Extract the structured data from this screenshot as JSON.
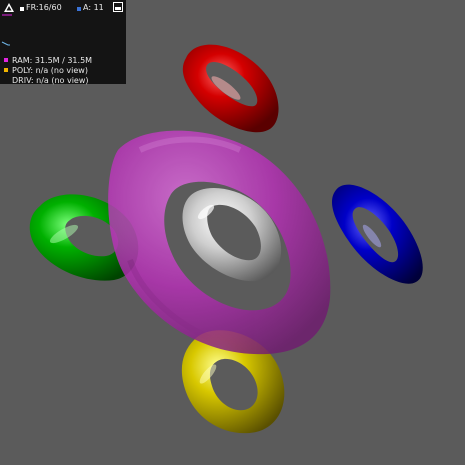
{
  "stats_panel": {
    "fps_text": "FR:16/60",
    "anim_text": "A: 11",
    "ram_text": "RAM:  31.5M / 31.5M",
    "poly_text": "POLY: n/a (no view)",
    "driv_text": "DRIV: n/a (no view)",
    "colors": {
      "fps": "#ffffff",
      "anim": "#3a72d6",
      "ram": "#e025e0",
      "poly": "#f0b400",
      "graph_line": "#6fb6e8",
      "graph_ram": "#e025e0"
    },
    "icons": {
      "logo": "triangle-logo-icon",
      "expand": "window-toggle-icon"
    }
  },
  "scene": {
    "background": "#5b5b5b",
    "objects": [
      {
        "name": "red-torus",
        "color": "#d40000"
      },
      {
        "name": "green-torus",
        "color": "#00b000"
      },
      {
        "name": "blue-torus",
        "color": "#0000c8"
      },
      {
        "name": "yellow-torus",
        "color": "#d8c800"
      },
      {
        "name": "white-torus",
        "color": "#e0e0e0"
      },
      {
        "name": "magenta-transparent-torus",
        "color": "#cc33cc"
      }
    ]
  }
}
